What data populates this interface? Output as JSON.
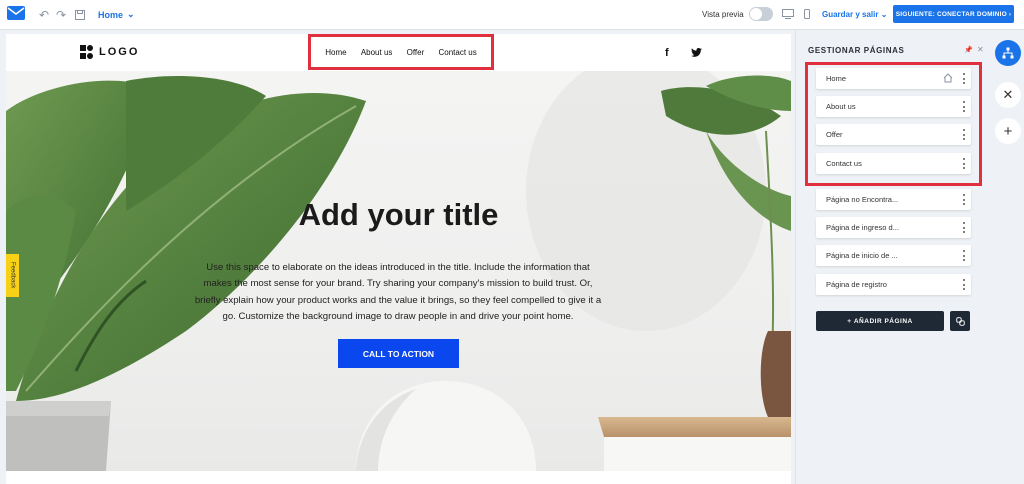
{
  "toolbar": {
    "page_selector": "Home",
    "preview_label": "Vista previa",
    "save_label": "Guardar y salir",
    "next_label": "SIGUIENTE: CONECTAR DOMINIO",
    "accent": "#1a73e8"
  },
  "site": {
    "logo_text": "LOGO",
    "menu": [
      "Home",
      "About us",
      "Offer",
      "Contact us"
    ],
    "social": [
      "f",
      "twitter-icon"
    ],
    "hero": {
      "title": "Add your title",
      "body": "Use this space to elaborate on the ideas introduced in the title. Include the information that makes the most sense for your brand. Try sharing your company's mission to build trust. Or, briefly explain how your product works and the value it brings, so they feel compelled to give it a go. Customize the background image to draw people in and drive your point home.",
      "cta": "CALL TO ACTION",
      "cta_color": "#0a47ee"
    },
    "feedback": "Feedback"
  },
  "panel": {
    "title": "GESTIONAR PÁGINAS",
    "pages": [
      {
        "label": "Home"
      },
      {
        "label": "About us"
      },
      {
        "label": "Offer"
      },
      {
        "label": "Contact us"
      },
      {
        "label": "Página no Encontra..."
      },
      {
        "label": "Página de ingreso d..."
      },
      {
        "label": "Página de inicio de ..."
      },
      {
        "label": "Página de registro"
      }
    ],
    "add_page": "AÑADIR PÁGINA",
    "highlight_color": "#e0303e"
  }
}
